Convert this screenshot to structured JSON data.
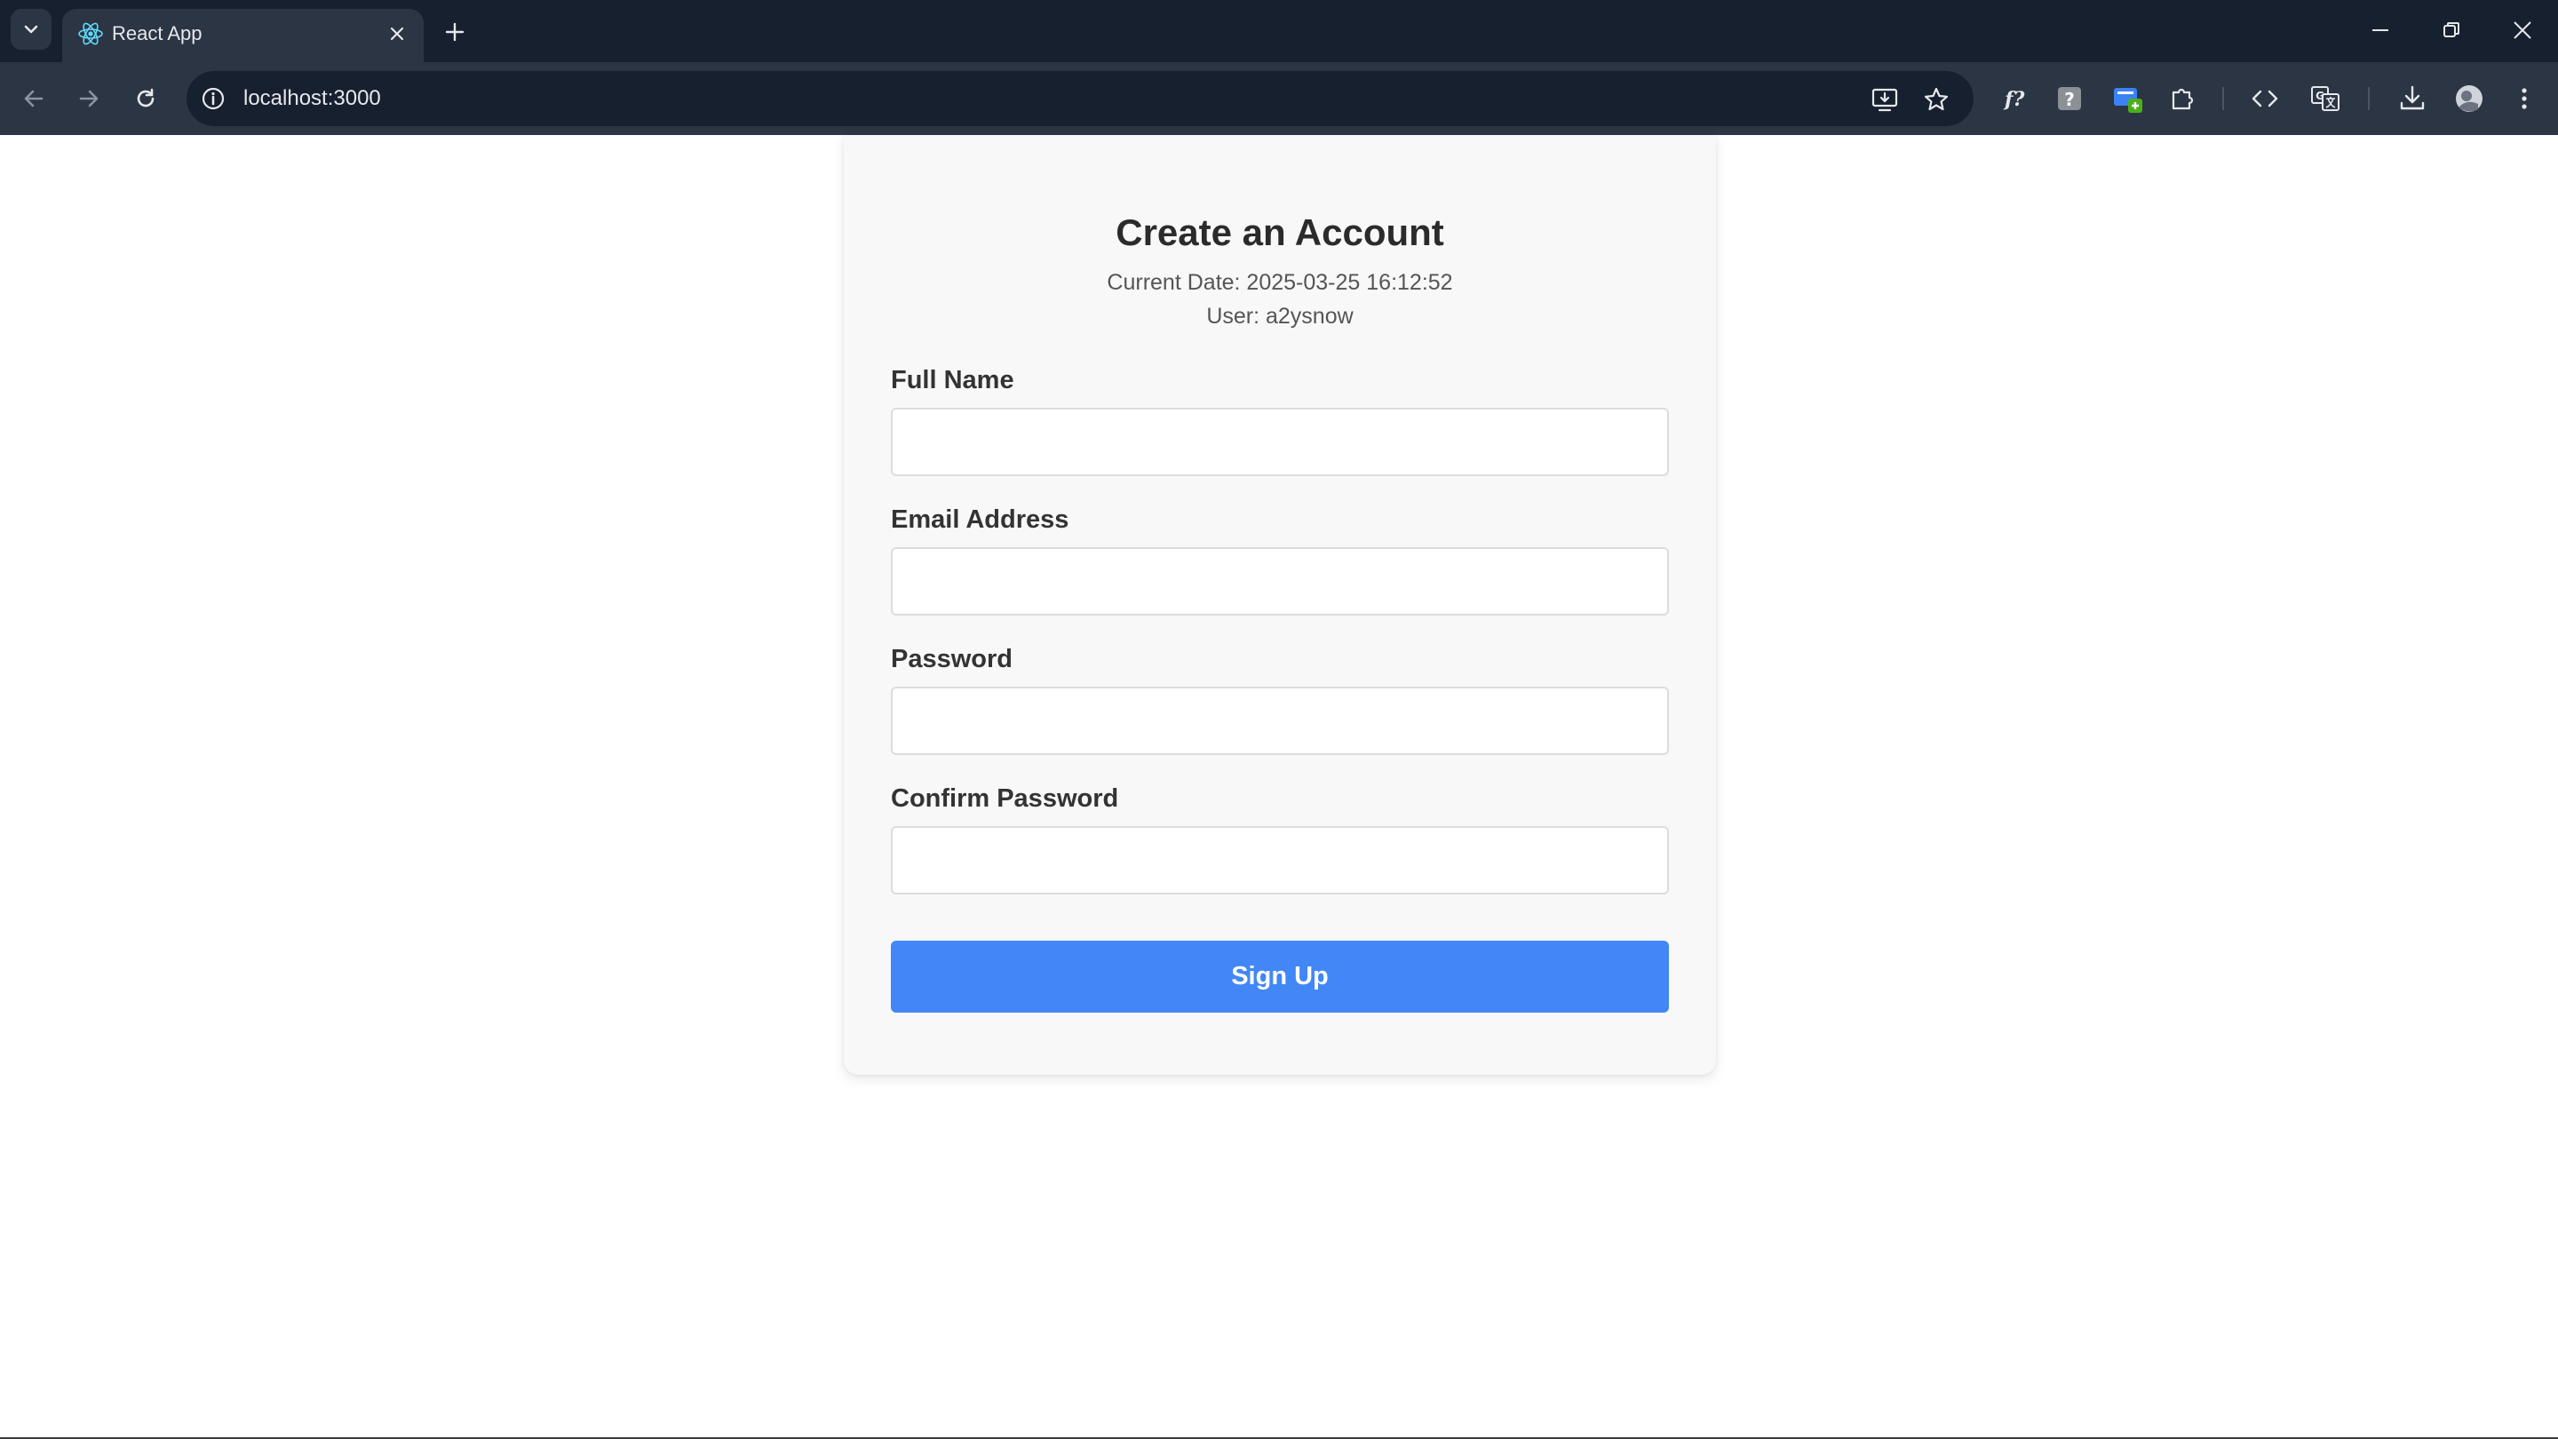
{
  "browser": {
    "tab": {
      "title": "React App"
    },
    "address_bar": {
      "url": "localhost:3000"
    }
  },
  "page": {
    "title": "Create an Account",
    "current_date": "Current Date: 2025-03-25 16:12:52",
    "user": "User: a2ysnow",
    "fields": [
      {
        "label": "Full Name",
        "value": "",
        "type": "text"
      },
      {
        "label": "Email Address",
        "value": "",
        "type": "email"
      },
      {
        "label": "Password",
        "value": "",
        "type": "password"
      },
      {
        "label": "Confirm Password",
        "value": "",
        "type": "password"
      }
    ],
    "submit_label": "Sign Up"
  },
  "colors": {
    "titlebar": "#17202e",
    "toolbar": "#2b3544",
    "card_background": "#f8f8f8",
    "accent_button": "#4287f5"
  },
  "icons": [
    "tab-search-icon",
    "react-logo-icon",
    "close-icon",
    "plus-icon",
    "minimize-icon",
    "restore-icon",
    "window-close-icon",
    "back-arrow-icon",
    "forward-arrow-icon",
    "reload-icon",
    "info-icon",
    "install-app-icon",
    "star-icon",
    "formula-extension-icon",
    "help-extension-icon",
    "screen-extension-icon",
    "puzzle-icon",
    "code-icon",
    "translate-icon",
    "download-icon",
    "profile-avatar-icon",
    "kebab-menu-icon"
  ]
}
